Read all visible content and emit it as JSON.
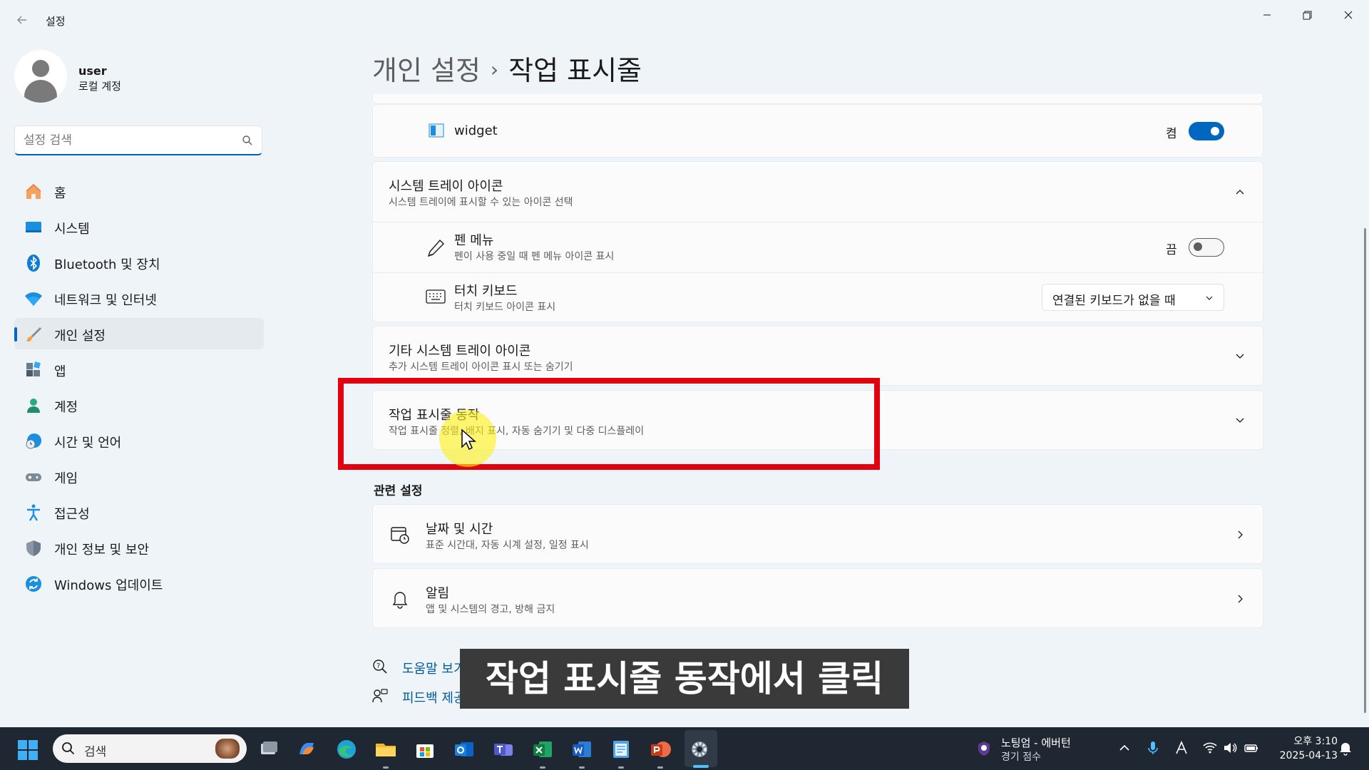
{
  "window": {
    "title": "설정",
    "back_icon": "back-arrow-icon",
    "controls": [
      "minimize-icon",
      "maximize-icon",
      "close-icon"
    ]
  },
  "profile": {
    "name": "user",
    "account_type": "로컬 계정"
  },
  "search": {
    "placeholder": "설정 검색"
  },
  "sidebar": {
    "items": [
      {
        "label": "홈",
        "icon": "home-icon"
      },
      {
        "label": "시스템",
        "icon": "system-icon"
      },
      {
        "label": "Bluetooth 및 장치",
        "icon": "bluetooth-icon"
      },
      {
        "label": "네트워크 및 인터넷",
        "icon": "wifi-icon"
      },
      {
        "label": "개인 설정",
        "icon": "brush-icon",
        "active": true
      },
      {
        "label": "앱",
        "icon": "apps-icon"
      },
      {
        "label": "계정",
        "icon": "account-icon"
      },
      {
        "label": "시간 및 언어",
        "icon": "time-language-icon"
      },
      {
        "label": "게임",
        "icon": "gamepad-icon"
      },
      {
        "label": "접근성",
        "icon": "accessibility-icon"
      },
      {
        "label": "개인 정보 및 보안",
        "icon": "shield-icon"
      },
      {
        "label": "Windows 업데이트",
        "icon": "update-icon"
      }
    ]
  },
  "breadcrumb": {
    "parent": "개인 설정",
    "separator": "›",
    "current": "작업 표시줄"
  },
  "main": {
    "widget": {
      "label": "widget",
      "state": "켬",
      "on": true
    },
    "system_tray": {
      "title": "시스템 트레이 아이콘",
      "subtitle": "시스템 트레이에 표시할 수 있는 아이콘 선택"
    },
    "pen_menu": {
      "title": "펜 메뉴",
      "subtitle": "펜이 사용 중일 때 펜 메뉴 아이콘 표시",
      "state": "끔",
      "on": false
    },
    "touch_keyboard": {
      "title": "터치 키보드",
      "subtitle": "터치 키보드 아이콘 표시",
      "dropdown_value": "연결된 키보드가 없을 때"
    },
    "other_tray": {
      "title": "기타 시스템 트레이 아이콘",
      "subtitle": "추가 시스템 트레이 아이콘 표시 또는 숨기기"
    },
    "taskbar_behaviors": {
      "title": "작업 표시줄 동작",
      "subtitle": "작업 표시줄 정렬, 배지 표시, 자동 숨기기 및 다중 디스플레이"
    }
  },
  "related": {
    "heading": "관련 설정",
    "items": [
      {
        "title": "날짜 및 시간",
        "subtitle": "표준 시간대, 자동 시계 설정, 일정 표시",
        "icon": "calendar-clock-icon"
      },
      {
        "title": "알림",
        "subtitle": "앱 및 시스템의 경고, 방해 금지",
        "icon": "bell-icon"
      }
    ]
  },
  "footer_links": {
    "help": "도움말 보기",
    "feedback": "피드백 제공"
  },
  "caption": "작업 표시줄 동작에서 클릭",
  "taskbar": {
    "search_label": "검색",
    "apps": [
      "task-view-icon",
      "copilot-icon",
      "edge-icon",
      "file-explorer-icon",
      "store-icon",
      "outlook-icon",
      "teams-icon",
      "excel-icon",
      "word-icon",
      "notepad-icon",
      "powerpoint-icon",
      "settings-icon"
    ],
    "weather": {
      "line1": "노팅엄 - 에버턴",
      "line2": "경기 점수"
    },
    "clock": {
      "time": "오후 3:10",
      "date": "2025-04-13"
    }
  },
  "colors": {
    "accent": "#0067c0",
    "highlight": "#e3000f",
    "taskbar_bg": "#1f2733",
    "window_bg": "#eff4f9"
  }
}
